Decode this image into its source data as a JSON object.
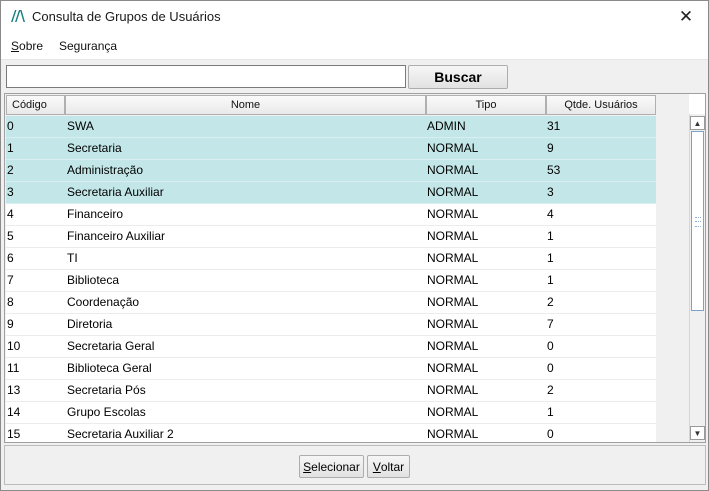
{
  "window": {
    "title": "Consulta de Grupos de Usuários",
    "close_glyph": "✕",
    "app_icon": "app-logo-icon"
  },
  "menu": {
    "items": [
      {
        "mnemonic": "S",
        "rest": "obre"
      },
      {
        "mnemonic": "",
        "rest": "Segurança"
      }
    ]
  },
  "search": {
    "value": "",
    "placeholder": "",
    "button_label": "Buscar"
  },
  "table": {
    "columns": [
      "Código",
      "Nome",
      "Tipo",
      "Qtde. Usuários"
    ],
    "selection_color": "#c3e7e8",
    "rows": [
      {
        "codigo": "0",
        "nome": "SWA",
        "tipo": "ADMIN",
        "qtde": "31",
        "selected": true
      },
      {
        "codigo": "1",
        "nome": "Secretaria",
        "tipo": "NORMAL",
        "qtde": "9",
        "selected": true
      },
      {
        "codigo": "2",
        "nome": "Administração",
        "tipo": "NORMAL",
        "qtde": "53",
        "selected": true
      },
      {
        "codigo": "3",
        "nome": "Secretaria Auxiliar",
        "tipo": "NORMAL",
        "qtde": "3",
        "selected": true
      },
      {
        "codigo": "4",
        "nome": "Financeiro",
        "tipo": "NORMAL",
        "qtde": "4",
        "selected": false
      },
      {
        "codigo": "5",
        "nome": "Financeiro Auxiliar",
        "tipo": "NORMAL",
        "qtde": "1",
        "selected": false
      },
      {
        "codigo": "6",
        "nome": "TI",
        "tipo": "NORMAL",
        "qtde": "1",
        "selected": false
      },
      {
        "codigo": "7",
        "nome": "Biblioteca",
        "tipo": "NORMAL",
        "qtde": "1",
        "selected": false
      },
      {
        "codigo": "8",
        "nome": "Coordenação",
        "tipo": "NORMAL",
        "qtde": "2",
        "selected": false
      },
      {
        "codigo": "9",
        "nome": "Diretoria",
        "tipo": "NORMAL",
        "qtde": "7",
        "selected": false
      },
      {
        "codigo": "10",
        "nome": "Secretaria Geral",
        "tipo": "NORMAL",
        "qtde": "0",
        "selected": false
      },
      {
        "codigo": "11",
        "nome": "Biblioteca Geral",
        "tipo": "NORMAL",
        "qtde": "0",
        "selected": false
      },
      {
        "codigo": "13",
        "nome": "Secretaria Pós",
        "tipo": "NORMAL",
        "qtde": "2",
        "selected": false
      },
      {
        "codigo": "14",
        "nome": "Grupo Escolas",
        "tipo": "NORMAL",
        "qtde": "1",
        "selected": false
      },
      {
        "codigo": "15",
        "nome": "Secretaria Auxiliar 2",
        "tipo": "NORMAL",
        "qtde": "0",
        "selected": false
      }
    ]
  },
  "scrollbar": {
    "up_glyph": "▲",
    "down_glyph": "▼"
  },
  "footer": {
    "select_mnemonic": "S",
    "select_rest": "elecionar",
    "back_mnemonic": "V",
    "back_rest": "oltar"
  }
}
